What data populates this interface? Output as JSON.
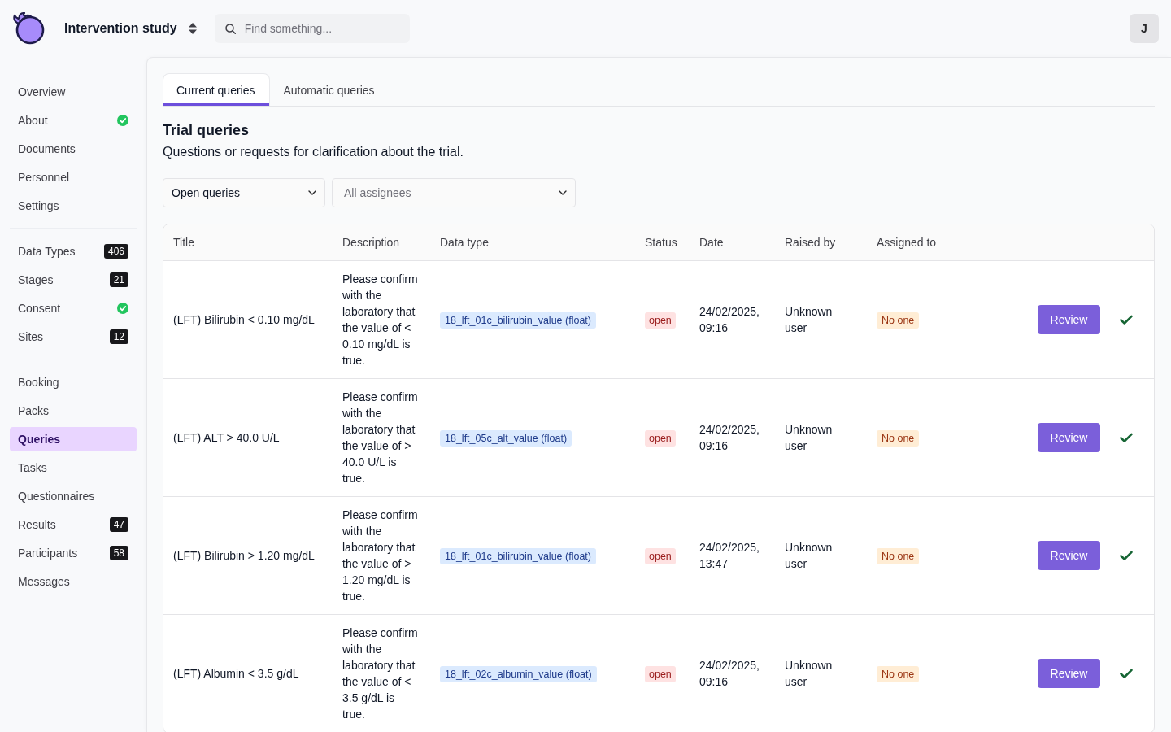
{
  "header": {
    "study_name": "Intervention study",
    "search": {
      "placeholder": "Find something..."
    },
    "avatar": "J"
  },
  "sidebar": {
    "groups": [
      {
        "items": [
          {
            "label": "Overview",
            "selected": false,
            "verified": false
          },
          {
            "label": "About",
            "selected": false,
            "verified": true
          },
          {
            "label": "Documents",
            "selected": false,
            "verified": false
          },
          {
            "label": "Personnel",
            "selected": false,
            "verified": false
          },
          {
            "label": "Settings",
            "selected": false,
            "verified": false
          }
        ]
      },
      {
        "items": [
          {
            "label": "Data Types",
            "selected": false,
            "verified": false,
            "badge": "406"
          },
          {
            "label": "Stages",
            "selected": false,
            "verified": false,
            "badge": "21"
          },
          {
            "label": "Consent",
            "selected": false,
            "verified": true
          },
          {
            "label": "Sites",
            "selected": false,
            "verified": false,
            "badge": "12"
          }
        ]
      },
      {
        "items": [
          {
            "label": "Booking",
            "selected": false,
            "verified": false
          },
          {
            "label": "Packs",
            "selected": false,
            "verified": false
          },
          {
            "label": "Queries",
            "selected": true,
            "verified": false
          },
          {
            "label": "Tasks",
            "selected": false,
            "verified": false
          },
          {
            "label": "Questionnaires",
            "selected": false,
            "verified": false
          },
          {
            "label": "Results",
            "selected": false,
            "verified": false,
            "badge": "47"
          },
          {
            "label": "Participants",
            "selected": false,
            "verified": false,
            "badge": "58"
          },
          {
            "label": "Messages",
            "selected": false,
            "verified": false
          }
        ]
      }
    ]
  },
  "tabs": [
    {
      "label": "Current queries",
      "selected": true
    },
    {
      "label": "Automatic queries",
      "selected": false
    }
  ],
  "heading": "Trial queries",
  "subtitle": "Questions or requests for clarification about the trial.",
  "filters": [
    {
      "value": "Open queries"
    },
    {
      "placeholder": "All assignees"
    }
  ],
  "table": {
    "columns": [
      "Title",
      "Description",
      "Data type",
      "Status",
      "Date",
      "Raised by",
      "Assigned to"
    ],
    "rows": [
      {
        "title": "(LFT) Bilirubin < 0.10 mg/dL",
        "description": "Please confirm with the laboratory that the value of < 0.10 mg/dL is true.",
        "data_type": "18_lft_01c_bilirubin_value (float)",
        "status": "open",
        "date": "24/02/2025, 09:16",
        "raised_by": "Unknown user",
        "assigned_to": "No one",
        "action": "Review"
      },
      {
        "title": "(LFT) ALT > 40.0 U/L",
        "description": "Please confirm with the laboratory that the value of > 40.0 U/L is true.",
        "data_type": "18_lft_05c_alt_value (float)",
        "status": "open",
        "date": "24/02/2025, 09:16",
        "raised_by": "Unknown user",
        "assigned_to": "No one",
        "action": "Review"
      },
      {
        "title": "(LFT) Bilirubin > 1.20 mg/dL",
        "description": "Please confirm with the laboratory that the value of > 1.20 mg/dL is true.",
        "data_type": "18_lft_01c_bilirubin_value (float)",
        "status": "open",
        "date": "24/02/2025, 13:47",
        "raised_by": "Unknown user",
        "assigned_to": "No one",
        "action": "Review"
      },
      {
        "title": "(LFT) Albumin < 3.5 g/dL",
        "description": "Please confirm with the laboratory that the value of < 3.5 g/dL is true.",
        "data_type": "18_lft_02c_albumin_value (float)",
        "status": "open",
        "date": "24/02/2025, 09:16",
        "raised_by": "Unknown user",
        "assigned_to": "No one",
        "action": "Review"
      }
    ]
  }
}
